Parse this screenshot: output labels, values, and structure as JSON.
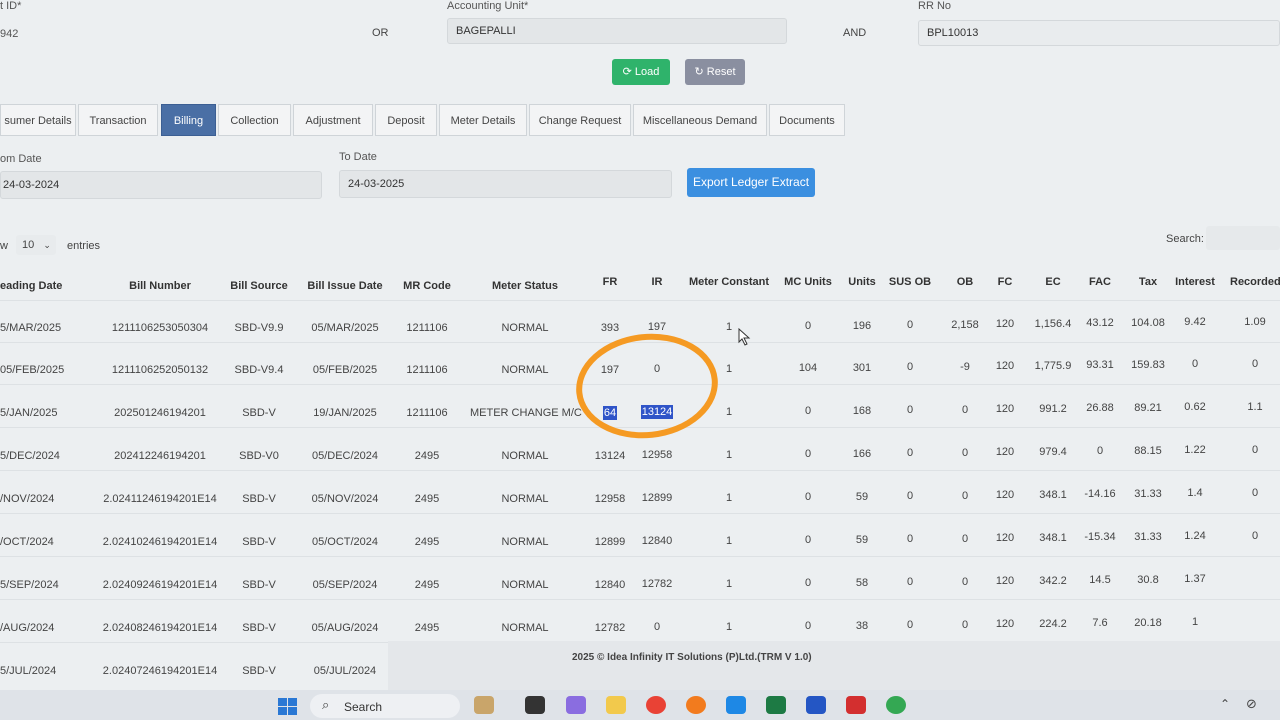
{
  "filters": {
    "left_label_partial": "t ID*",
    "left_value_partial": "942",
    "or_text": "OR",
    "accounting_unit_label": "Accounting Unit*",
    "accounting_unit_value": "BAGEPALLI",
    "and_text": "AND",
    "rr_label": "RR No",
    "rr_value": "BPL10013",
    "load_label": "Load",
    "reset_label": "Reset"
  },
  "tabs": [
    {
      "label": "sumer Details"
    },
    {
      "label": "Transaction"
    },
    {
      "label": "Billing"
    },
    {
      "label": "Collection"
    },
    {
      "label": "Adjustment"
    },
    {
      "label": "Deposit"
    },
    {
      "label": "Meter Details"
    },
    {
      "label": "Change Request"
    },
    {
      "label": "Miscellaneous Demand"
    },
    {
      "label": "Documents"
    }
  ],
  "date_filter": {
    "from_label": "om Date",
    "from_value": "24-03-2024",
    "to_label": "To Date",
    "to_value": "24-03-2025",
    "export_label": "Export Ledger Extract"
  },
  "table_controls": {
    "show_label": "w",
    "page_size": "10",
    "entries_label": "entries",
    "search_label": "Search:"
  },
  "columns": [
    "eading Date",
    "Bill Number",
    "Bill Source",
    "Bill Issue Date",
    "MR Code",
    "Meter Status",
    "FR",
    "IR",
    "Meter Constant",
    "MC Units",
    "Units",
    "SUS OB",
    "OB",
    "FC",
    "EC",
    "FAC",
    "Tax",
    "Interest",
    "Recorded"
  ],
  "rows": [
    [
      "5/MAR/2025",
      "1211106253050304",
      "SBD-V9.9",
      "05/MAR/2025",
      "1211106",
      "NORMAL",
      "393",
      "197",
      "1",
      "0",
      "196",
      "0",
      "2,158",
      "120",
      "1,156.4",
      "43.12",
      "104.08",
      "9.42",
      "1.09"
    ],
    [
      "05/FEB/2025",
      "1211106252050132",
      "SBD-V9.4",
      "05/FEB/2025",
      "1211106",
      "NORMAL",
      "197",
      "0",
      "1",
      "104",
      "301",
      "0",
      "-9",
      "120",
      "1,775.9",
      "93.31",
      "159.83",
      "0",
      "0"
    ],
    [
      "5/JAN/2025",
      "202501246194201",
      "SBD-V",
      "19/JAN/2025",
      "1211106",
      "METER CHANGE M/C",
      "64",
      "13124",
      "1",
      "0",
      "168",
      "0",
      "0",
      "120",
      "991.2",
      "26.88",
      "89.21",
      "0.62",
      "1.1"
    ],
    [
      "5/DEC/2024",
      "202412246194201",
      "SBD-V0",
      "05/DEC/2024",
      "2495",
      "NORMAL",
      "13124",
      "12958",
      "1",
      "0",
      "166",
      "0",
      "0",
      "120",
      "979.4",
      "0",
      "88.15",
      "1.22",
      "0"
    ],
    [
      "/NOV/2024",
      "2.02411246194201E14",
      "SBD-V",
      "05/NOV/2024",
      "2495",
      "NORMAL",
      "12958",
      "12899",
      "1",
      "0",
      "59",
      "0",
      "0",
      "120",
      "348.1",
      "-14.16",
      "31.33",
      "1.4",
      "0"
    ],
    [
      "/OCT/2024",
      "2.02410246194201E14",
      "SBD-V",
      "05/OCT/2024",
      "2495",
      "NORMAL",
      "12899",
      "12840",
      "1",
      "0",
      "59",
      "0",
      "0",
      "120",
      "348.1",
      "-15.34",
      "31.33",
      "1.24",
      "0"
    ],
    [
      "5/SEP/2024",
      "2.02409246194201E14",
      "SBD-V",
      "05/SEP/2024",
      "2495",
      "NORMAL",
      "12840",
      "12782",
      "1",
      "0",
      "58",
      "0",
      "0",
      "120",
      "342.2",
      "14.5",
      "30.8",
      "1.37",
      ""
    ],
    [
      "/AUG/2024",
      "2.02408246194201E14",
      "SBD-V",
      "05/AUG/2024",
      "2495",
      "NORMAL",
      "12782",
      "0",
      "1",
      "0",
      "38",
      "0",
      "0",
      "120",
      "224.2",
      "7.6",
      "20.18",
      "1",
      ""
    ],
    [
      "5/JUL/2024",
      "2.02407246194201E14",
      "SBD-V",
      "05/JUL/2024",
      "",
      "",
      "",
      "",
      "",
      "",
      "",
      "",
      "",
      "",
      "",
      "",
      "",
      "",
      ""
    ]
  ],
  "footer": "2025 © Idea Infinity IT Solutions (P)Ltd.(TRM V 1.0)",
  "taskbar": {
    "search_placeholder": "Search"
  },
  "colors": {
    "load": "#2fb36b",
    "reset": "#8a8fa0",
    "export": "#3b8fe0",
    "active_tab": "#4a6fa5",
    "highlight": "#2f54c8",
    "annotation": "#f59a23"
  }
}
